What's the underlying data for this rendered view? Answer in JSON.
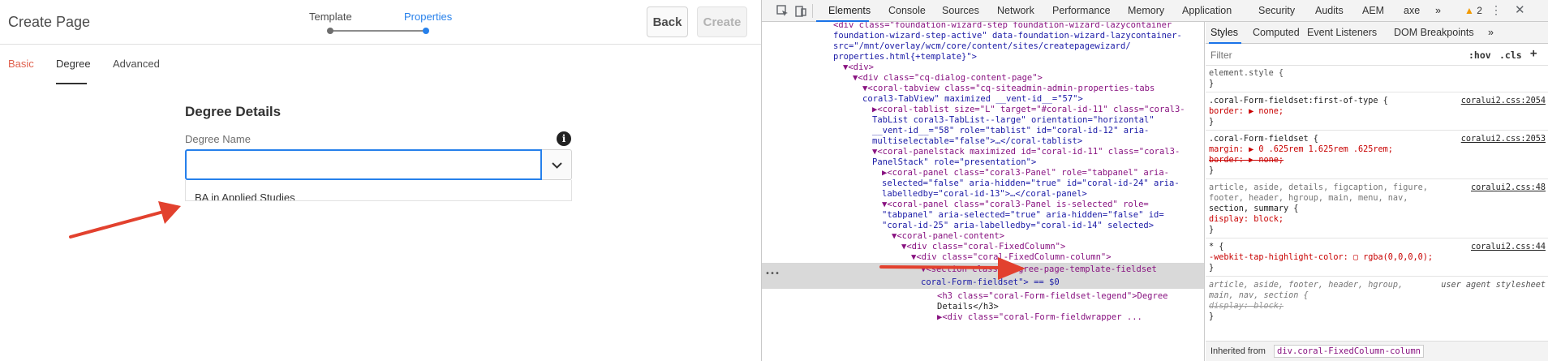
{
  "app": {
    "title": "Create Page",
    "steps": [
      "Template",
      "Properties"
    ],
    "back_label": "Back",
    "create_label": "Create",
    "tabs": [
      "Basic",
      "Degree",
      "Advanced"
    ],
    "section_legend": "Degree Details",
    "field_label": "Degree Name",
    "input_value": "",
    "options": [
      "BA in Applied Studies"
    ],
    "info_glyph": "i"
  },
  "devtools": {
    "tabs": [
      "Elements",
      "Console",
      "Sources",
      "Network",
      "Performance",
      "Memory",
      "Application",
      "Security",
      "Audits",
      "AEM",
      "axe"
    ],
    "more": "»",
    "warning_count": "2",
    "dom_lines": [
      "<div class=\"foundation-wizard-step foundation-wizard-lazycontainer",
      "foundation-wizard-step-active\" data-foundation-wizard-lazycontainer-",
      "src=\"/mnt/overlay/wcm/core/content/sites/createpagewizard/",
      "properties.html{+template}\">",
      "▼<div>",
      "▼<div class=\"cq-dialog-content-page\">",
      "▼<coral-tabview class=\"cq-siteadmin-admin-properties-tabs",
      "coral3-TabView\" maximized __vent-id__=\"57\">",
      "▶<coral-tablist size=\"L\" target=\"#coral-id-11\" class=\"coral3-",
      "TabList coral3-TabList--large\" orientation=\"horizontal\"",
      "__vent-id__=\"58\" role=\"tablist\" id=\"coral-id-12\" aria-",
      "multiselectable=\"false\">…</coral-tablist>",
      "▼<coral-panelstack maximized id=\"coral-id-11\" class=\"coral3-",
      "PanelStack\" role=\"presentation\">",
      "▶<coral-panel class=\"coral3-Panel\" role=\"tabpanel\" aria-",
      "selected=\"false\" aria-hidden=\"true\" id=\"coral-id-24\" aria-",
      "labelledby=\"coral-id-13\">…</coral-panel>",
      "▼<coral-panel class=\"coral3-Panel is-selected\" role=",
      "\"tabpanel\" aria-selected=\"true\" aria-hidden=\"false\" id=",
      "\"coral-id-25\" aria-labelledby=\"coral-id-14\" selected>",
      "▼<coral-panel-content>",
      "▼<div class=\"coral-FixedColumn\">",
      "▼<div class=\"coral-FixedColumn-column\">",
      "▼<section class=\"degree-page-template-fieldset",
      "coral-Form-fieldset\"> == $0",
      "<h3 class=\"coral-Form-fieldset-legend\">Degree",
      "Details</h3>",
      "▶<div class=\"coral-Form-fieldwrapper ..."
    ],
    "dom_dots": "•••",
    "styles": {
      "tabs": [
        "Styles",
        "Computed",
        "Event Listeners",
        "DOM Breakpoints"
      ],
      "more": "»",
      "filter_placeholder": "Filter",
      "hov": ":hov",
      "cls": ".cls",
      "plus": "+",
      "lines": [
        "element.style {",
        "}",
        ".coral-Form-fieldset:first-of-type {",
        "  border: ▶ none;",
        "}",
        ".coral-Form-fieldset {",
        "  margin: ▶ 0 .625rem 1.625rem .625rem;",
        "  border: ▶ none;",
        "}",
        "article, aside, details, figcaption, figure,",
        "footer, header, hgroup, main, menu, nav,",
        "section, summary {",
        "  display: block;",
        "}",
        "* {",
        "  -webkit-tap-highlight-color: ▢ rgba(0,0,0,0);",
        "}",
        "article, aside, footer, header, hgroup,",
        "main, nav, section {",
        "  display: block;",
        "}"
      ],
      "sources": [
        "coralui2.css:2054",
        "coralui2.css:2053",
        "coralui2.css:48",
        "coralui2.css:44",
        "user agent stylesheet"
      ],
      "inherited_label": "Inherited from",
      "inherited_from": "div.coral-FixedColumn-column"
    }
  },
  "colors": {
    "accent_blue": "#2680eb",
    "basic_tab": "#e0614e",
    "arrow_red": "#e2412e",
    "devtools_tab_blue": "#1a73e8"
  }
}
